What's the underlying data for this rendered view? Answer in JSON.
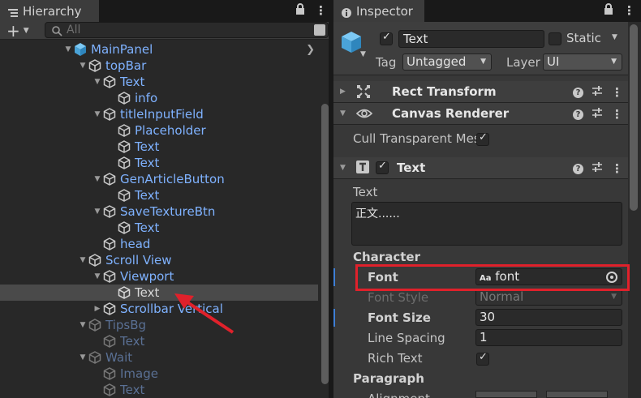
{
  "hierarchy": {
    "tab_label": "Hierarchy",
    "add_label": "+",
    "search_placeholder": "All",
    "items": [
      {
        "label": "MainPanel",
        "style": "prefab"
      },
      {
        "label": "topBar",
        "style": "normal"
      },
      {
        "label": "Text",
        "style": "normal"
      },
      {
        "label": "info",
        "style": "normal"
      },
      {
        "label": "titleInputField",
        "style": "normal"
      },
      {
        "label": "Placeholder",
        "style": "normal"
      },
      {
        "label": "Text",
        "style": "normal"
      },
      {
        "label": "Text",
        "style": "normal"
      },
      {
        "label": "GenArticleButton",
        "style": "normal"
      },
      {
        "label": "Text",
        "style": "normal"
      },
      {
        "label": "SaveTextureBtn",
        "style": "normal"
      },
      {
        "label": "Text",
        "style": "normal"
      },
      {
        "label": "head",
        "style": "normal"
      },
      {
        "label": "Scroll View",
        "style": "normal"
      },
      {
        "label": "Viewport",
        "style": "normal"
      },
      {
        "label": "Text",
        "style": "selected"
      },
      {
        "label": "Scrollbar Vertical",
        "style": "normal"
      },
      {
        "label": "TipsBg",
        "style": "disabled"
      },
      {
        "label": "Text",
        "style": "disabled"
      },
      {
        "label": "Wait",
        "style": "disabled"
      },
      {
        "label": "Image",
        "style": "disabled"
      },
      {
        "label": "Text",
        "style": "disabled"
      }
    ]
  },
  "inspector": {
    "tab_label": "Inspector",
    "object_name": "Text",
    "static_label": "Static",
    "tag_label": "Tag",
    "tag_value": "Untagged",
    "layer_label": "Layer",
    "layer_value": "UI",
    "components": {
      "rect_transform": "Rect Transform",
      "canvas_renderer": "Canvas Renderer",
      "text": "Text"
    },
    "cull_label": "Cull Transparent Mes",
    "text_label": "Text",
    "text_value": "正文......",
    "character_header": "Character",
    "font_label": "Font",
    "font_icon_text": "Aa",
    "font_value": "font",
    "font_style_label": "Font Style",
    "font_style_value": "Normal",
    "font_size_label": "Font Size",
    "font_size_value": "30",
    "line_spacing_label": "Line Spacing",
    "line_spacing_value": "1",
    "rich_text_label": "Rich Text",
    "paragraph_header": "Paragraph",
    "alignment_label": "Alignment"
  },
  "colors": {
    "hierarchy_label": "#7fb2ff",
    "disabled_label": "#5a7094",
    "highlight_box": "#e0212b",
    "arrow": "#e0212b"
  }
}
